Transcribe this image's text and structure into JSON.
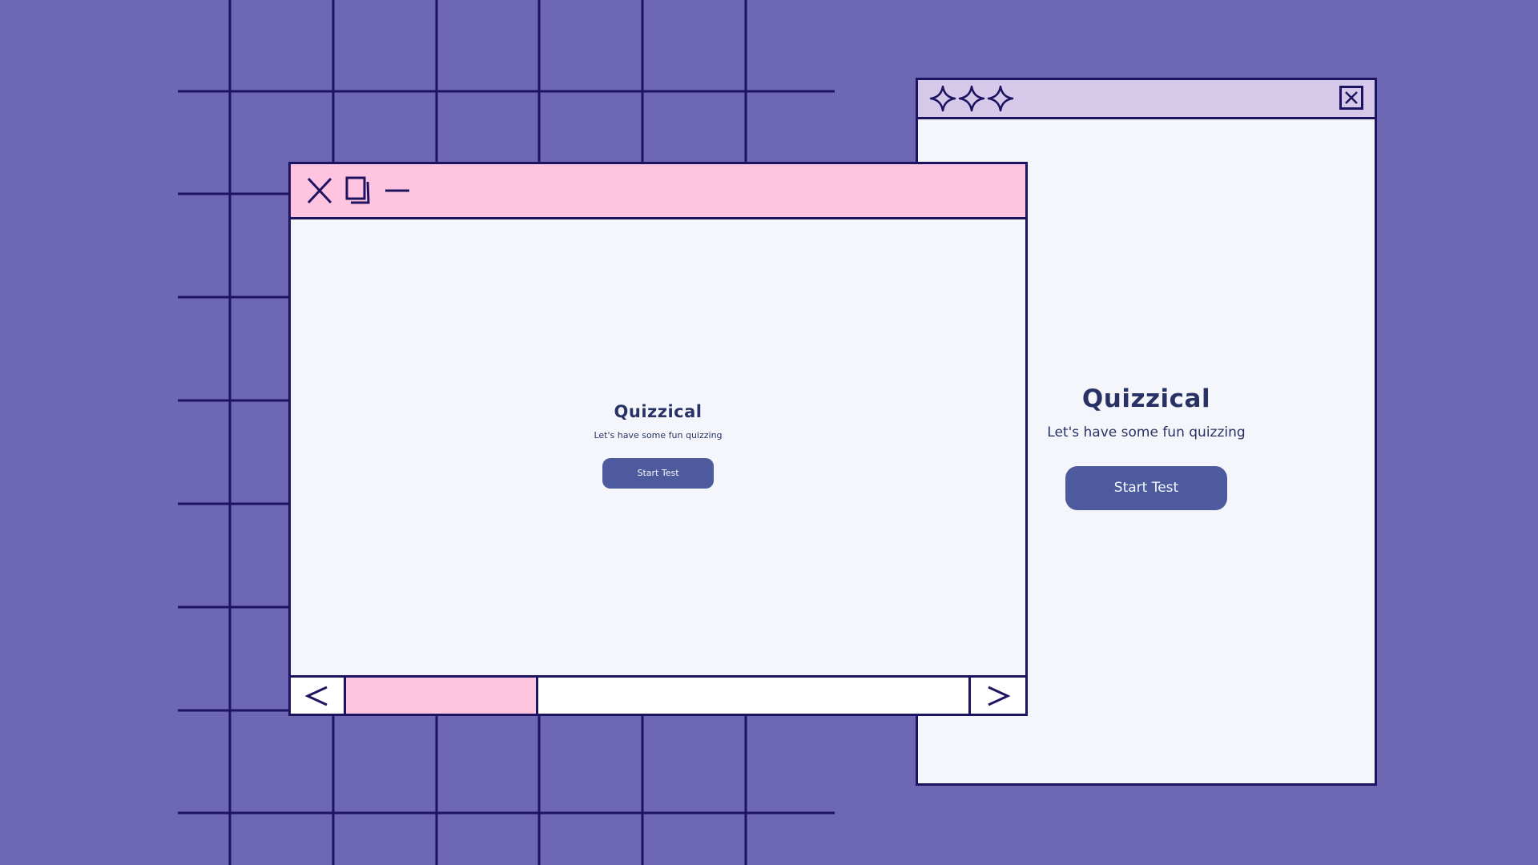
{
  "colors": {
    "background": "#6e67b4",
    "grid_line": "#1d1461",
    "front_titlebar": "#ffc4df",
    "back_titlebar": "#d5c8e8",
    "content_bg": "#f5f6fb",
    "text": "#293264",
    "button": "#4d5b9e",
    "button_text": "#f5f7fb"
  },
  "back_window": {
    "titlebar_icons": [
      "sparkle-icon",
      "sparkle-icon",
      "sparkle-icon",
      "close-icon"
    ],
    "title": "Quizzical",
    "subtitle": "Let's have some fun quizzing",
    "button_label": "Start Test"
  },
  "front_window": {
    "titlebar_icons": [
      "close-icon",
      "restore-icon",
      "minimize-icon"
    ],
    "title": "Quizzical",
    "subtitle": "Let's have some fun quizzing",
    "button_label": "Start Test",
    "scrollbar": {
      "left_icon": "chevron-left-icon",
      "right_icon": "chevron-right-icon"
    }
  }
}
